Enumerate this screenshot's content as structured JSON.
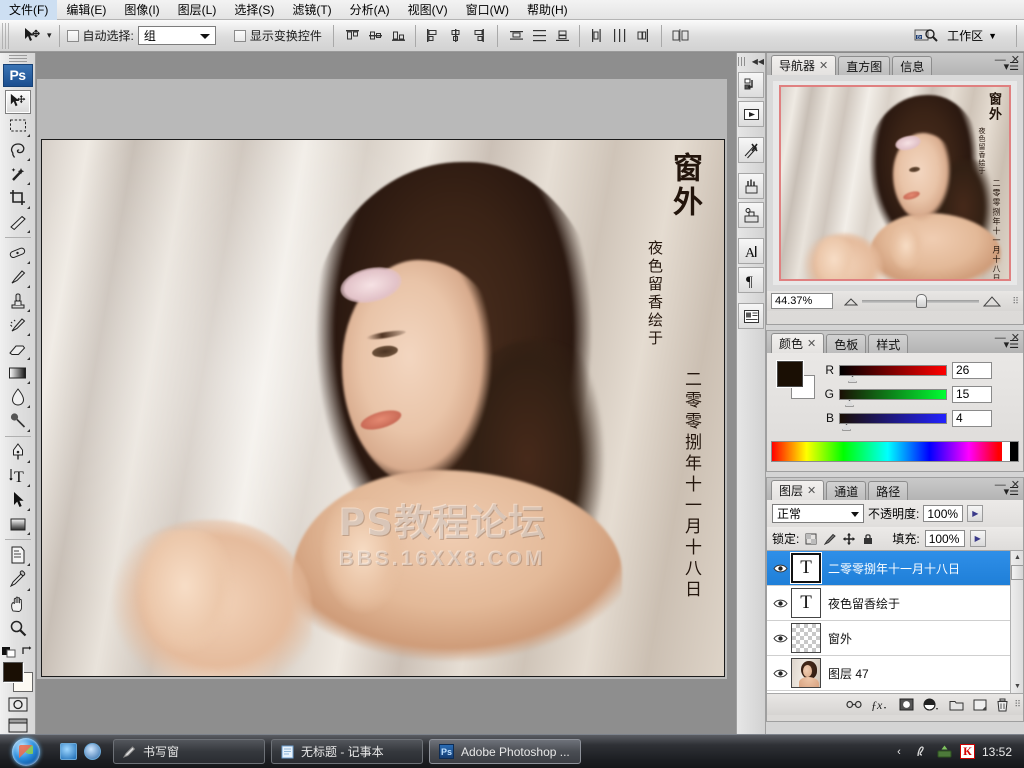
{
  "app": {
    "name": "Adobe Photoshop"
  },
  "menubar": {
    "items": [
      {
        "label": "文件(F)"
      },
      {
        "label": "编辑(E)"
      },
      {
        "label": "图像(I)"
      },
      {
        "label": "图层(L)"
      },
      {
        "label": "选择(S)"
      },
      {
        "label": "滤镜(T)"
      },
      {
        "label": "分析(A)"
      },
      {
        "label": "视图(V)"
      },
      {
        "label": "窗口(W)"
      },
      {
        "label": "帮助(H)"
      }
    ]
  },
  "options_bar": {
    "tool_icon": "move-tool-icon",
    "auto_select_label": "自动选择:",
    "auto_select_value": "组",
    "show_transform_label": "显示变换控件",
    "align_icons": [
      "align-top-edges-icon",
      "align-vertical-centers-icon",
      "align-bottom-edges-icon",
      "align-left-edges-icon",
      "align-horizontal-centers-icon",
      "align-right-edges-icon"
    ],
    "distribute_icons": [
      "distribute-top-edges-icon",
      "distribute-vertical-centers-icon",
      "distribute-bottom-edges-icon",
      "distribute-left-edges-icon",
      "distribute-horizontal-centers-icon",
      "distribute-right-edges-icon"
    ],
    "auto_align_icon": "auto-align-layers-icon",
    "bridge_label": "Br",
    "workspace_label": "工作区"
  },
  "toolbar": {
    "logo": "Ps",
    "tools": [
      {
        "name": "move-tool",
        "glyph": "➤",
        "selected": true
      },
      {
        "name": "marquee-tool",
        "glyph": "▭",
        "selected": false
      },
      {
        "name": "lasso-tool",
        "glyph": "🪢",
        "selected": false
      },
      {
        "name": "magic-wand-tool",
        "glyph": "✨",
        "selected": false
      },
      {
        "name": "crop-tool",
        "glyph": "⌗",
        "selected": false
      },
      {
        "name": "slice-tool",
        "glyph": "✂",
        "selected": false
      },
      {
        "name": "healing-brush-tool",
        "glyph": "🩹",
        "selected": false
      },
      {
        "name": "brush-tool",
        "glyph": "🖌",
        "selected": false
      },
      {
        "name": "clone-stamp-tool",
        "glyph": "⎙",
        "selected": false
      },
      {
        "name": "history-brush-tool",
        "glyph": "🖍",
        "selected": false
      },
      {
        "name": "eraser-tool",
        "glyph": "◻",
        "selected": false
      },
      {
        "name": "gradient-tool",
        "glyph": "▤",
        "selected": false
      },
      {
        "name": "blur-tool",
        "glyph": "💧",
        "selected": false
      },
      {
        "name": "dodge-tool",
        "glyph": "●",
        "selected": false
      },
      {
        "name": "pen-tool",
        "glyph": "✒",
        "selected": false
      },
      {
        "name": "type-tool",
        "glyph": "T",
        "selected": false
      },
      {
        "name": "path-selection-tool",
        "glyph": "➚",
        "selected": false
      },
      {
        "name": "rectangle-shape-tool",
        "glyph": "▣",
        "selected": false
      },
      {
        "name": "notes-tool",
        "glyph": "🗒",
        "selected": false
      },
      {
        "name": "eyedropper-tool",
        "glyph": "💉",
        "selected": false
      },
      {
        "name": "hand-tool",
        "glyph": "✋",
        "selected": false
      },
      {
        "name": "zoom-tool",
        "glyph": "🔍",
        "selected": false
      }
    ],
    "foreground_color": "#1a0f04",
    "background_color": "#fdfaf3",
    "quickmask_icon": "quick-mask-icon",
    "screenmode_icon": "screen-mode-icon"
  },
  "dock_strip": {
    "buttons": [
      {
        "name": "history-panel-icon",
        "glyph": "↺"
      },
      {
        "name": "actions-panel-icon",
        "glyph": "▶"
      },
      {
        "name": "tool-presets-panel-icon",
        "glyph": "✕"
      },
      {
        "name": "brushes-panel-icon",
        "glyph": "🖌"
      },
      {
        "name": "clone-source-panel-icon",
        "glyph": "⎘"
      },
      {
        "name": "character-panel-icon",
        "glyph": "A"
      },
      {
        "name": "paragraph-panel-icon",
        "glyph": "¶"
      },
      {
        "name": "layer-comps-panel-icon",
        "glyph": "▤"
      }
    ],
    "collapse_icon": "collapse-dock-icon"
  },
  "navigator_panel": {
    "tabs": [
      {
        "label": "导航器",
        "active": true,
        "closable": true
      },
      {
        "label": "直方图",
        "active": false,
        "closable": false
      },
      {
        "label": "信息",
        "active": false,
        "closable": false
      }
    ],
    "zoom_value": "44.37%",
    "zoom_out_icon": "zoom-out-icon",
    "zoom_in_icon": "zoom-in-icon",
    "minimize_icon": "minimize-icon",
    "close_icon": "close-icon",
    "menu_icon": "panel-menu-icon"
  },
  "color_panel": {
    "tabs": [
      {
        "label": "颜色",
        "active": true,
        "closable": true
      },
      {
        "label": "色板",
        "active": false,
        "closable": false
      },
      {
        "label": "样式",
        "active": false,
        "closable": false
      }
    ],
    "channels": [
      {
        "label": "R",
        "value": "26",
        "pos": 10
      },
      {
        "label": "G",
        "value": "15",
        "pos": 6
      },
      {
        "label": "B",
        "value": "4",
        "pos": 2
      }
    ],
    "foreground_color": "#1a0f04",
    "background_color": "#ffffff"
  },
  "layers_panel": {
    "tabs": [
      {
        "label": "图层",
        "active": true,
        "closable": true
      },
      {
        "label": "通道",
        "active": false,
        "closable": false
      },
      {
        "label": "路径",
        "active": false,
        "closable": false
      }
    ],
    "blend_mode": "正常",
    "opacity_label": "不透明度:",
    "opacity_value": "100%",
    "lock_label": "锁定:",
    "lock_icons": [
      "lock-transparency-icon",
      "lock-image-icon",
      "lock-position-icon",
      "lock-all-icon"
    ],
    "fill_label": "填充:",
    "fill_value": "100%",
    "layers": [
      {
        "name": "二零零捌年十一月十八日",
        "type": "text",
        "thumb": "T",
        "visible": true,
        "selected": true
      },
      {
        "name": "夜色留香绘于",
        "type": "text",
        "thumb": "T",
        "visible": true,
        "selected": false
      },
      {
        "name": "窗外",
        "type": "transparent",
        "thumb": "",
        "visible": true,
        "selected": false
      },
      {
        "name": "图层 47",
        "type": "image",
        "thumb": "",
        "visible": true,
        "selected": false
      }
    ],
    "footer_icons": [
      {
        "name": "link-layers-icon",
        "glyph": "⛓"
      },
      {
        "name": "layer-style-fx-icon",
        "glyph": "ƒx"
      },
      {
        "name": "add-layer-mask-icon",
        "glyph": "◑"
      },
      {
        "name": "adjustment-layer-icon",
        "glyph": "◐"
      },
      {
        "name": "new-group-icon",
        "glyph": "▭"
      },
      {
        "name": "new-layer-icon",
        "glyph": "◳"
      },
      {
        "name": "delete-layer-icon",
        "glyph": "🗑"
      }
    ]
  },
  "document": {
    "artwork_title": "窗外",
    "artwork_subtitle": "夜色留香绘于",
    "artwork_date": "二零零捌年十一月十八日",
    "watermark_line1": "PS教程论坛",
    "watermark_line2": "BBS.16XX8.COM"
  },
  "taskbar": {
    "start_label": "start-orb",
    "quicklaunch": [
      {
        "name": "quicklaunch-ie-icon"
      },
      {
        "name": "quicklaunch-show-desktop-icon"
      }
    ],
    "items": [
      {
        "label": "书写窗",
        "icon": "pen-icon",
        "active": false
      },
      {
        "label": "无标题 - 记事本",
        "icon": "notepad-icon",
        "active": false
      },
      {
        "label": "Adobe Photoshop ...",
        "icon": "photoshop-icon",
        "active": true
      }
    ],
    "tray": [
      {
        "name": "show-hidden-icons-icon",
        "glyph": "‹"
      },
      {
        "name": "input-method-icon",
        "glyph": "✍"
      },
      {
        "name": "safely-remove-hardware-icon",
        "glyph": "⏏"
      },
      {
        "name": "kaspersky-icon",
        "glyph": "К"
      }
    ],
    "clock": "13:52"
  }
}
